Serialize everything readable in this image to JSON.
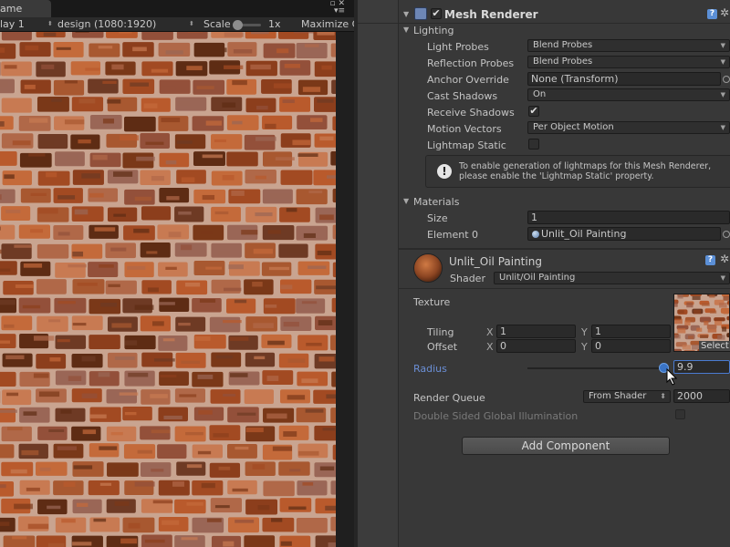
{
  "game_view": {
    "tab_title": "ame",
    "display_label": "lay 1",
    "resolution_label": "design (1080:1920)",
    "scale_label": "Scale",
    "scale_value": "1x",
    "maximize_label": "Maximize C"
  },
  "mesh_renderer": {
    "title": "Mesh Renderer",
    "enabled": true,
    "lighting_label": "Lighting",
    "light_probes_label": "Light Probes",
    "light_probes_value": "Blend Probes",
    "reflection_probes_label": "Reflection Probes",
    "reflection_probes_value": "Blend Probes",
    "anchor_override_label": "Anchor Override",
    "anchor_override_value": "None (Transform)",
    "cast_shadows_label": "Cast Shadows",
    "cast_shadows_value": "On",
    "receive_shadows_label": "Receive Shadows",
    "receive_shadows_checked": true,
    "motion_vectors_label": "Motion Vectors",
    "motion_vectors_value": "Per Object Motion",
    "lightmap_static_label": "Lightmap Static",
    "lightmap_static_checked": false,
    "info_line1": "To enable generation of lightmaps for this Mesh Renderer,",
    "info_line2": "please enable the 'Lightmap Static' property.",
    "materials_label": "Materials",
    "size_label": "Size",
    "size_value": "1",
    "element0_label": "Element 0",
    "element0_value": "Unlit_Oil Painting"
  },
  "material": {
    "name": "Unlit_Oil Painting",
    "shader_label": "Shader",
    "shader_value": "Unlit/Oil Painting",
    "texture_label": "Texture",
    "tiling_label": "Tiling",
    "offset_label": "Offset",
    "x_label": "X",
    "y_label": "Y",
    "tiling_x": "1",
    "tiling_y": "1",
    "offset_x": "0",
    "offset_y": "0",
    "select_label": "Select",
    "radius_label": "Radius",
    "radius_value": "9.9",
    "radius_fraction": 0.99,
    "render_queue_label": "Render Queue",
    "render_queue_mode": "From Shader",
    "render_queue_value": "2000",
    "double_sided_gi_label": "Double Sided Global Illumination",
    "double_sided_gi_checked": false
  },
  "add_component_label": "Add Component",
  "colors": {
    "accent_blue": "#4a7bd0",
    "radius_label_blue": "#6b8fd6",
    "panel_bg": "#383838"
  },
  "icons": {
    "help": "help-icon",
    "gear": "gear-icon",
    "info": "info-icon",
    "mesh_renderer": "mesh-renderer-icon",
    "material_sphere": "material-icon"
  }
}
